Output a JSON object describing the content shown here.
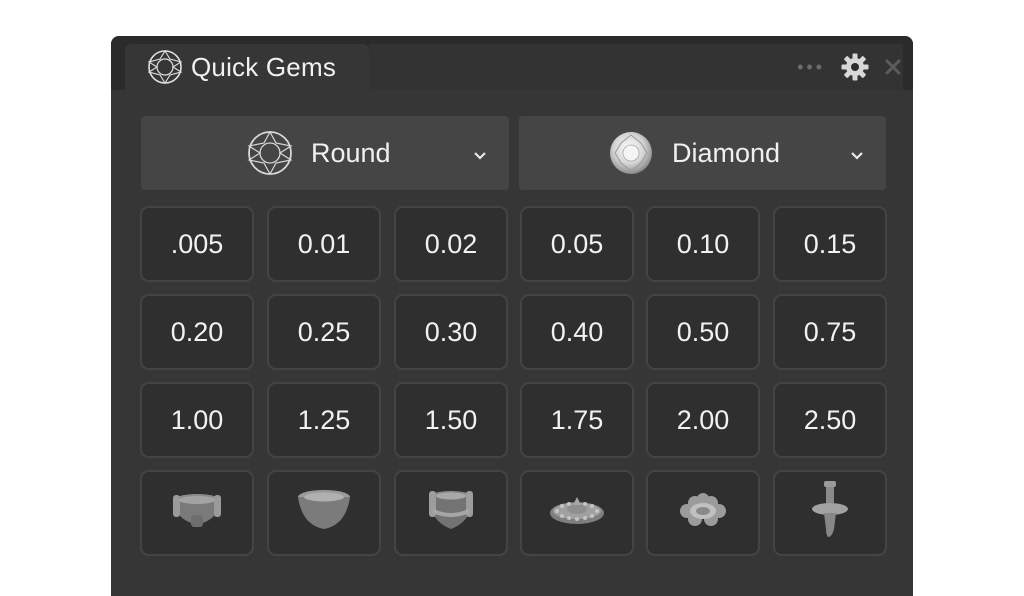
{
  "window": {
    "title": "Quick Gems",
    "title_icon": "round-gem-outline-icon",
    "actions": {
      "more_icon": "more-dots-icon",
      "settings_icon": "gear-icon",
      "close_icon": "close-icon"
    }
  },
  "dropdowns": {
    "shape": {
      "label": "Round",
      "icon": "round-cut-icon"
    },
    "material": {
      "label": "Diamond",
      "icon": "diamond-stone-icon"
    }
  },
  "carat_sizes": [
    [
      ".005",
      "0.01",
      "0.02",
      "0.05",
      "0.10",
      "0.15"
    ],
    [
      "0.20",
      "0.25",
      "0.30",
      "0.40",
      "0.50",
      "0.75"
    ],
    [
      "1.00",
      "1.25",
      "1.50",
      "1.75",
      "2.00",
      "2.50"
    ]
  ],
  "settings": [
    {
      "icon": "prong-setting-icon"
    },
    {
      "icon": "bezel-setting-icon"
    },
    {
      "icon": "basket-setting-icon"
    },
    {
      "icon": "halo-setting-icon"
    },
    {
      "icon": "flower-halo-setting-icon"
    },
    {
      "icon": "peg-setting-icon"
    }
  ],
  "colors": {
    "panel_bg": "#363636",
    "titlebar_bg": "#2b2b2b",
    "dropdown_bg": "#454545",
    "cell_bg": "#2f2f2f",
    "cell_border": "#444444",
    "text": "#f0f0f0"
  }
}
